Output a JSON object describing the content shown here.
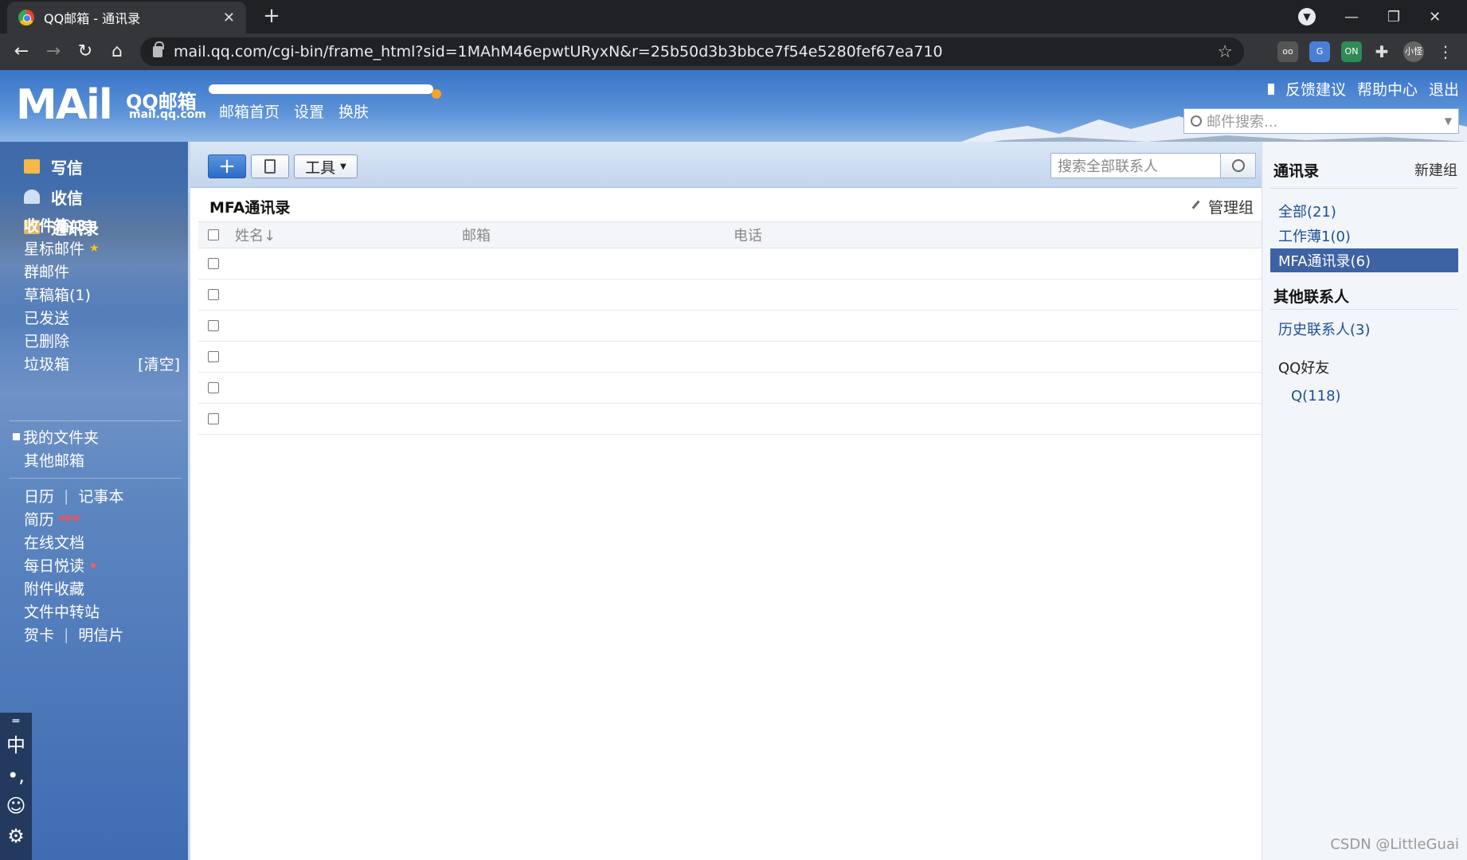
{
  "browser": {
    "tab_title": "QQ邮箱 - 通讯录",
    "url": "mail.qq.com/cgi-bin/frame_html?sid=1MAhM46epwtURyxN&r=25b50d3b3bbce7f54e5280fef67ea710",
    "profile_label": "小怪",
    "ext_on_label": "ON"
  },
  "header": {
    "logo_text": "MAil",
    "logo_cn": "QQ邮箱",
    "logo_en": "mail.qq.com",
    "nav": [
      "邮箱首页",
      "设置",
      "换肤"
    ],
    "top_links": [
      "反馈建议",
      "帮助中心",
      "退出"
    ],
    "search_placeholder": "邮件搜索..."
  },
  "sidebar": {
    "main": [
      {
        "label": "写信",
        "icon": "write-icon",
        "color": "#f5b84a"
      },
      {
        "label": "收信",
        "icon": "inbox-icon",
        "color": "#d0dff2"
      },
      {
        "label": "通讯录",
        "icon": "contacts-icon",
        "color": "#e0b86a"
      }
    ],
    "folders": [
      {
        "label": "收件箱(3)",
        "bold": true
      },
      {
        "label": "星标邮件"
      },
      {
        "label": "群邮件"
      },
      {
        "label": "草稿箱(1)"
      },
      {
        "label": "已发送"
      },
      {
        "label": "已删除"
      },
      {
        "label": "垃圾箱",
        "extra": "[清空]"
      }
    ],
    "my_folders": "我的文件夹",
    "other_mailbox": "其他邮箱",
    "tools": [
      {
        "label": "日历",
        "second": "记事本"
      },
      {
        "label": "简历",
        "badge": "NEW"
      },
      {
        "label": "在线文档"
      },
      {
        "label": "每日悦读"
      },
      {
        "label": "附件收藏"
      },
      {
        "label": "文件中转站"
      },
      {
        "label": "贺卡",
        "second": "明信片"
      }
    ],
    "ime": [
      "中",
      "•,",
      "☺",
      "⚙"
    ]
  },
  "main": {
    "tools_label": "工具",
    "contact_search_placeholder": "搜索全部联系人",
    "group_title": "MFA通讯录",
    "manage_label": "管理组",
    "columns": [
      "姓名↓",
      "邮箱",
      "电话"
    ],
    "row_count": 6
  },
  "rightbar": {
    "title": "通讯录",
    "new_group": "新建组",
    "groups": [
      "全部(21)",
      "工作薄1(0)",
      "MFA通讯录(6)"
    ],
    "active_group_index": 2,
    "other_title": "其他联系人",
    "history": "历史联系人(3)",
    "qq_friends": "QQ好友",
    "qq_sub": "Q(118)"
  },
  "watermark": "CSDN @LittleGuai",
  "colors": {
    "accent": "#3e62a4",
    "header_blue": "#3a74c8"
  }
}
